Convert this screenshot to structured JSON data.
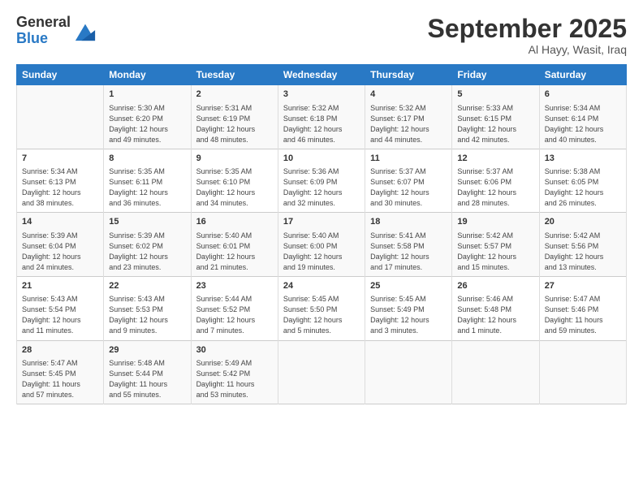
{
  "logo": {
    "general": "General",
    "blue": "Blue"
  },
  "title": "September 2025",
  "location": "Al Hayy, Wasit, Iraq",
  "days_header": [
    "Sunday",
    "Monday",
    "Tuesday",
    "Wednesday",
    "Thursday",
    "Friday",
    "Saturday"
  ],
  "weeks": [
    [
      {
        "num": "",
        "info": ""
      },
      {
        "num": "1",
        "info": "Sunrise: 5:30 AM\nSunset: 6:20 PM\nDaylight: 12 hours\nand 49 minutes."
      },
      {
        "num": "2",
        "info": "Sunrise: 5:31 AM\nSunset: 6:19 PM\nDaylight: 12 hours\nand 48 minutes."
      },
      {
        "num": "3",
        "info": "Sunrise: 5:32 AM\nSunset: 6:18 PM\nDaylight: 12 hours\nand 46 minutes."
      },
      {
        "num": "4",
        "info": "Sunrise: 5:32 AM\nSunset: 6:17 PM\nDaylight: 12 hours\nand 44 minutes."
      },
      {
        "num": "5",
        "info": "Sunrise: 5:33 AM\nSunset: 6:15 PM\nDaylight: 12 hours\nand 42 minutes."
      },
      {
        "num": "6",
        "info": "Sunrise: 5:34 AM\nSunset: 6:14 PM\nDaylight: 12 hours\nand 40 minutes."
      }
    ],
    [
      {
        "num": "7",
        "info": "Sunrise: 5:34 AM\nSunset: 6:13 PM\nDaylight: 12 hours\nand 38 minutes."
      },
      {
        "num": "8",
        "info": "Sunrise: 5:35 AM\nSunset: 6:11 PM\nDaylight: 12 hours\nand 36 minutes."
      },
      {
        "num": "9",
        "info": "Sunrise: 5:35 AM\nSunset: 6:10 PM\nDaylight: 12 hours\nand 34 minutes."
      },
      {
        "num": "10",
        "info": "Sunrise: 5:36 AM\nSunset: 6:09 PM\nDaylight: 12 hours\nand 32 minutes."
      },
      {
        "num": "11",
        "info": "Sunrise: 5:37 AM\nSunset: 6:07 PM\nDaylight: 12 hours\nand 30 minutes."
      },
      {
        "num": "12",
        "info": "Sunrise: 5:37 AM\nSunset: 6:06 PM\nDaylight: 12 hours\nand 28 minutes."
      },
      {
        "num": "13",
        "info": "Sunrise: 5:38 AM\nSunset: 6:05 PM\nDaylight: 12 hours\nand 26 minutes."
      }
    ],
    [
      {
        "num": "14",
        "info": "Sunrise: 5:39 AM\nSunset: 6:04 PM\nDaylight: 12 hours\nand 24 minutes."
      },
      {
        "num": "15",
        "info": "Sunrise: 5:39 AM\nSunset: 6:02 PM\nDaylight: 12 hours\nand 23 minutes."
      },
      {
        "num": "16",
        "info": "Sunrise: 5:40 AM\nSunset: 6:01 PM\nDaylight: 12 hours\nand 21 minutes."
      },
      {
        "num": "17",
        "info": "Sunrise: 5:40 AM\nSunset: 6:00 PM\nDaylight: 12 hours\nand 19 minutes."
      },
      {
        "num": "18",
        "info": "Sunrise: 5:41 AM\nSunset: 5:58 PM\nDaylight: 12 hours\nand 17 minutes."
      },
      {
        "num": "19",
        "info": "Sunrise: 5:42 AM\nSunset: 5:57 PM\nDaylight: 12 hours\nand 15 minutes."
      },
      {
        "num": "20",
        "info": "Sunrise: 5:42 AM\nSunset: 5:56 PM\nDaylight: 12 hours\nand 13 minutes."
      }
    ],
    [
      {
        "num": "21",
        "info": "Sunrise: 5:43 AM\nSunset: 5:54 PM\nDaylight: 12 hours\nand 11 minutes."
      },
      {
        "num": "22",
        "info": "Sunrise: 5:43 AM\nSunset: 5:53 PM\nDaylight: 12 hours\nand 9 minutes."
      },
      {
        "num": "23",
        "info": "Sunrise: 5:44 AM\nSunset: 5:52 PM\nDaylight: 12 hours\nand 7 minutes."
      },
      {
        "num": "24",
        "info": "Sunrise: 5:45 AM\nSunset: 5:50 PM\nDaylight: 12 hours\nand 5 minutes."
      },
      {
        "num": "25",
        "info": "Sunrise: 5:45 AM\nSunset: 5:49 PM\nDaylight: 12 hours\nand 3 minutes."
      },
      {
        "num": "26",
        "info": "Sunrise: 5:46 AM\nSunset: 5:48 PM\nDaylight: 12 hours\nand 1 minute."
      },
      {
        "num": "27",
        "info": "Sunrise: 5:47 AM\nSunset: 5:46 PM\nDaylight: 11 hours\nand 59 minutes."
      }
    ],
    [
      {
        "num": "28",
        "info": "Sunrise: 5:47 AM\nSunset: 5:45 PM\nDaylight: 11 hours\nand 57 minutes."
      },
      {
        "num": "29",
        "info": "Sunrise: 5:48 AM\nSunset: 5:44 PM\nDaylight: 11 hours\nand 55 minutes."
      },
      {
        "num": "30",
        "info": "Sunrise: 5:49 AM\nSunset: 5:42 PM\nDaylight: 11 hours\nand 53 minutes."
      },
      {
        "num": "",
        "info": ""
      },
      {
        "num": "",
        "info": ""
      },
      {
        "num": "",
        "info": ""
      },
      {
        "num": "",
        "info": ""
      }
    ]
  ]
}
